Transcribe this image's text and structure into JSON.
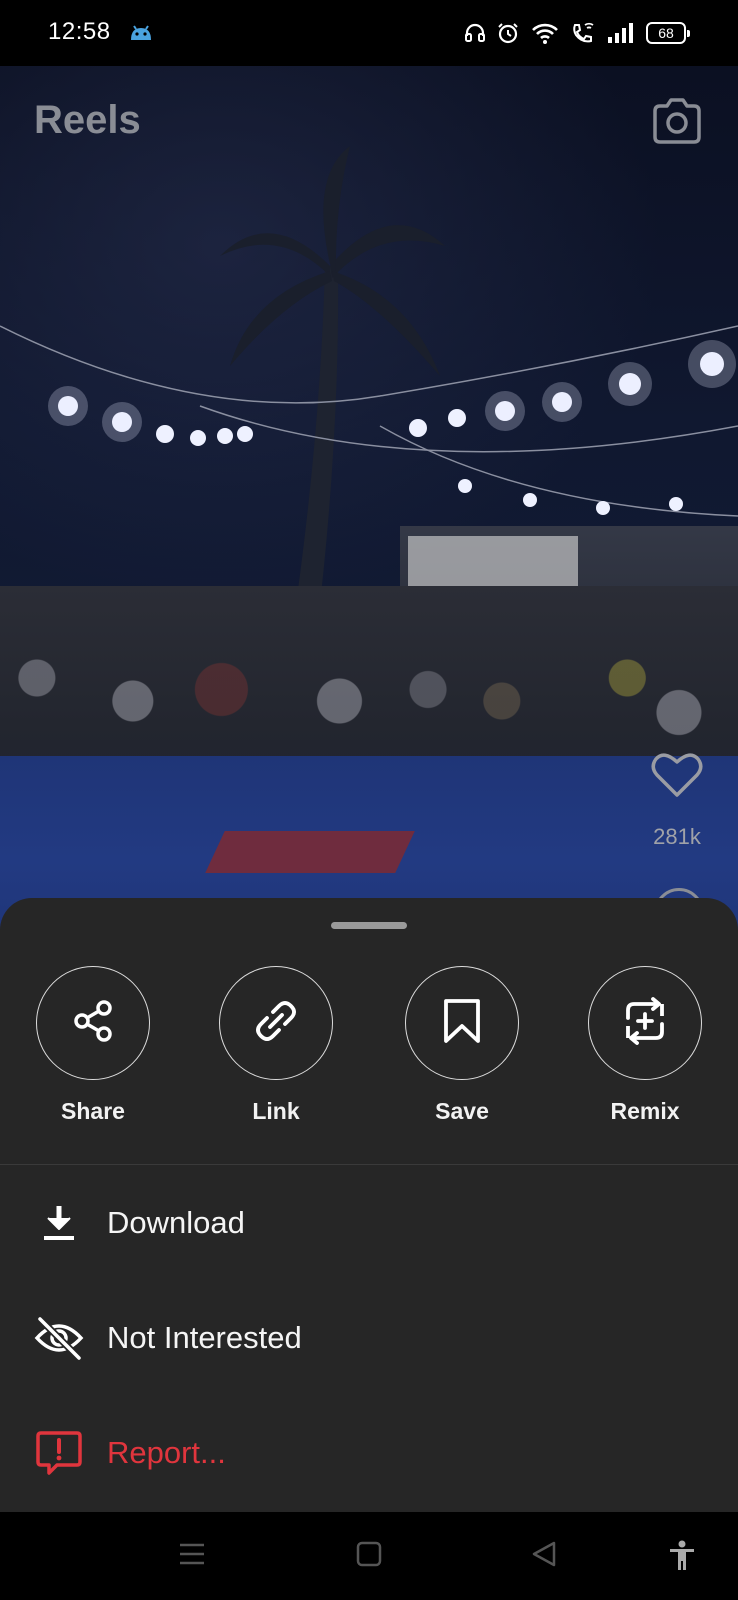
{
  "status_bar": {
    "time": "12:58",
    "battery": "68",
    "icons": [
      "android-icon",
      "headset-icon",
      "alarm-icon",
      "wifi-icon",
      "wifi-call-icon",
      "signal-icon",
      "battery-icon"
    ]
  },
  "reel": {
    "title": "Reels",
    "like_count": "281k",
    "icons": [
      "camera-icon",
      "heart-icon",
      "comment-icon"
    ]
  },
  "sheet": {
    "actions": [
      {
        "label": "Share",
        "icon": "share-icon"
      },
      {
        "label": "Link",
        "icon": "link-icon"
      },
      {
        "label": "Save",
        "icon": "bookmark-icon"
      },
      {
        "label": "Remix",
        "icon": "remix-icon"
      }
    ],
    "menu": [
      {
        "label": "Download",
        "icon": "download-icon"
      },
      {
        "label": "Not Interested",
        "icon": "eye-off-icon"
      },
      {
        "label": "Report...",
        "icon": "report-icon"
      }
    ]
  },
  "nav_bar": {
    "icons": [
      "menu-icon",
      "home-icon",
      "back-icon",
      "accessibility-icon"
    ]
  },
  "colors": {
    "sheet_bg": "#262626",
    "report_red": "#e0353d",
    "text": "#f5f5f5"
  }
}
